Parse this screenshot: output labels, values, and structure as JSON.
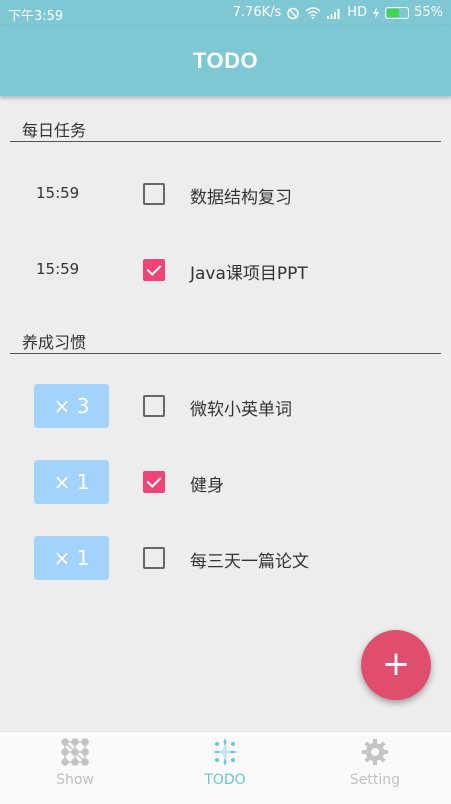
{
  "status": {
    "time": "下午3:59",
    "speed": "7.76K/s",
    "network": "HD",
    "battery": "55%"
  },
  "appbar": {
    "title": "TODO"
  },
  "daily": {
    "header": "每日任务",
    "items": [
      {
        "time": "15:59",
        "label": "数据结构复习",
        "checked": false
      },
      {
        "time": "15:59",
        "label": "Java课项目PPT",
        "checked": true
      }
    ]
  },
  "habits": {
    "header": "养成习惯",
    "items": [
      {
        "count": "× 3",
        "label": "微软小英单词",
        "checked": false
      },
      {
        "count": "× 1",
        "label": "健身",
        "checked": true
      },
      {
        "count": "× 1",
        "label": "每三天一篇论文",
        "checked": false
      }
    ]
  },
  "fab": {
    "icon": "plus-icon",
    "symbol": "+"
  },
  "nav": [
    {
      "label": "Show",
      "icon": "grid-icon",
      "active": false
    },
    {
      "label": "TODO",
      "icon": "sparkle-icon",
      "active": true
    },
    {
      "label": "Setting",
      "icon": "gear-icon",
      "active": false
    }
  ],
  "colors": {
    "accent": "#7fc7d3",
    "checked": "#f04479",
    "fab": "#df4f6d",
    "badge": "#a2d3fb",
    "nav_active": "#6cc4d7"
  }
}
